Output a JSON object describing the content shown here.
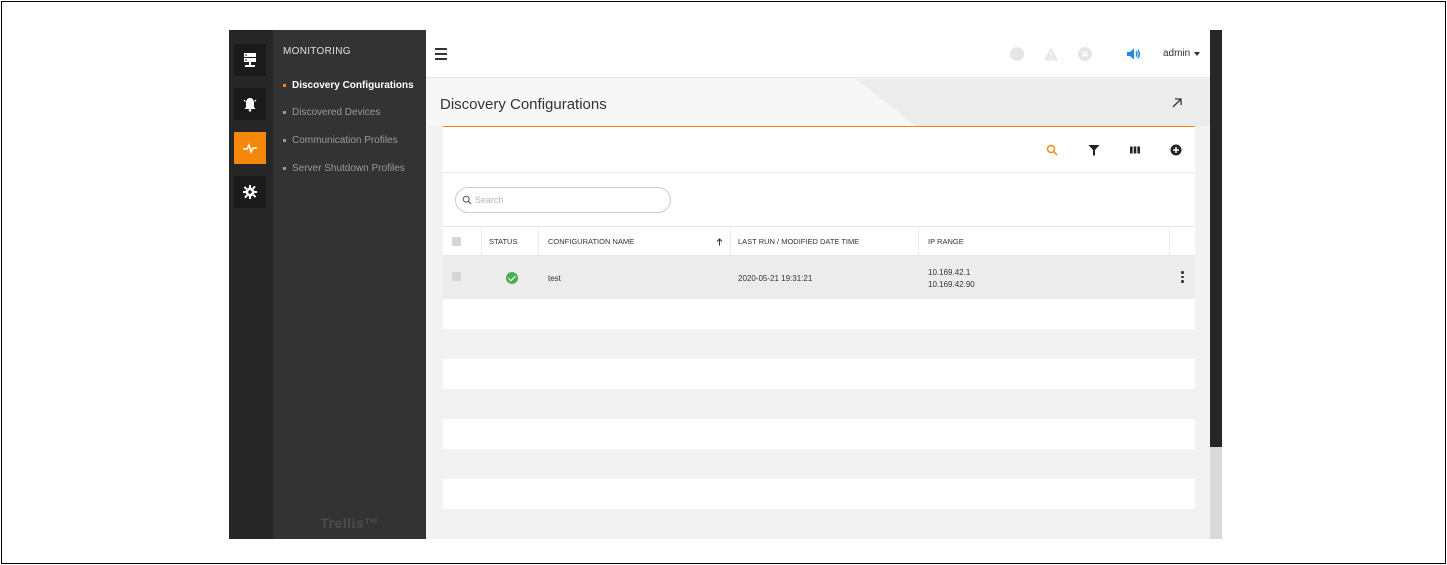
{
  "nav": {
    "heading": "MONITORING",
    "items": [
      {
        "label": "Discovery Configurations",
        "active": true
      },
      {
        "label": "Discovered Devices",
        "active": false
      },
      {
        "label": "Communication Profiles",
        "active": false
      },
      {
        "label": "Server Shutdown Profiles",
        "active": false
      }
    ],
    "brand": "Trellis™"
  },
  "rail": {
    "icons": [
      "server-icon",
      "alarm-bell-icon",
      "pulse-icon",
      "gear-icon"
    ],
    "active": "pulse-icon"
  },
  "topbar": {
    "user": "admin",
    "icons": [
      "info-status-icon",
      "warning-status-icon",
      "error-status-icon",
      "speaker-icon"
    ]
  },
  "page": {
    "title": "Discovery Configurations"
  },
  "search": {
    "placeholder": "Search"
  },
  "table": {
    "headers": {
      "status": "STATUS",
      "name": "CONFIGURATION NAME",
      "last_run": "LAST RUN / MODIFIED DATE TIME",
      "ip_range": "IP RANGE"
    },
    "sort": {
      "column": "name",
      "direction": "ascending"
    },
    "rows": [
      {
        "status": "ok",
        "name": "test",
        "last_run": "2020-05-21 19:31:21",
        "ip_start": "10.169.42.1",
        "ip_end": "10.169.42.90"
      }
    ]
  },
  "colors": {
    "accent": "#f5870a",
    "nav_bg": "#333333",
    "rail_bg": "#262626",
    "status_ok": "#4caf50",
    "speaker": "#1e88e5"
  }
}
